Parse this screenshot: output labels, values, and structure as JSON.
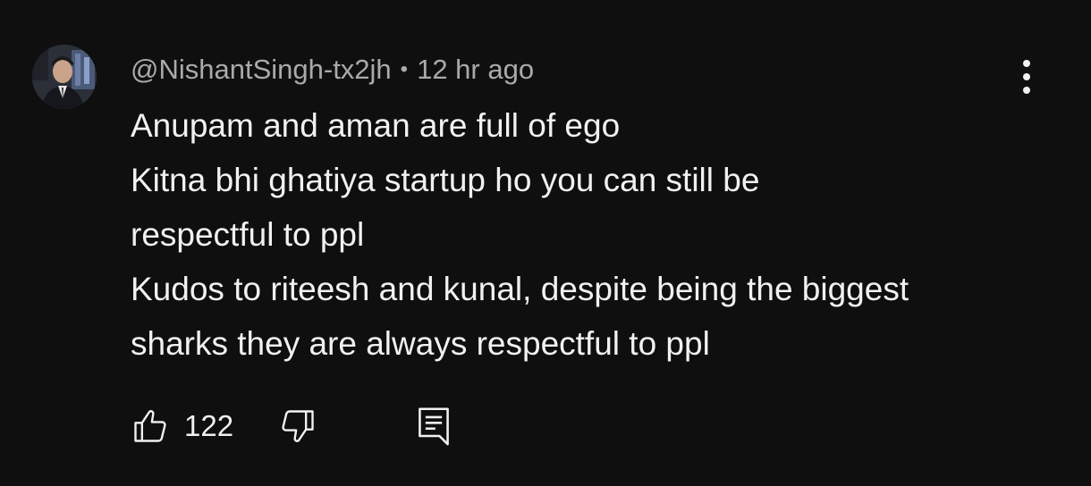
{
  "comment": {
    "author": "@NishantSingh-tx2jh",
    "separator": "•",
    "timestamp": "12 hr ago",
    "lines": [
      "Anupam and aman are full of ego",
      "Kitna bhi ghatiya startup ho you can still be",
      "respectful to ppl",
      "Kudos to riteesh and kunal, despite being the biggest",
      "sharks they are always respectful to ppl"
    ],
    "like_count": "122"
  },
  "icons": {
    "like": "thumbs-up-icon",
    "dislike": "thumbs-down-icon",
    "reply": "comment-reply-icon",
    "more": "more-vertical-icon"
  },
  "colors": {
    "background": "#0f0f0f",
    "primary_text": "#f1f1f1",
    "secondary_text": "#aaaaaa"
  }
}
